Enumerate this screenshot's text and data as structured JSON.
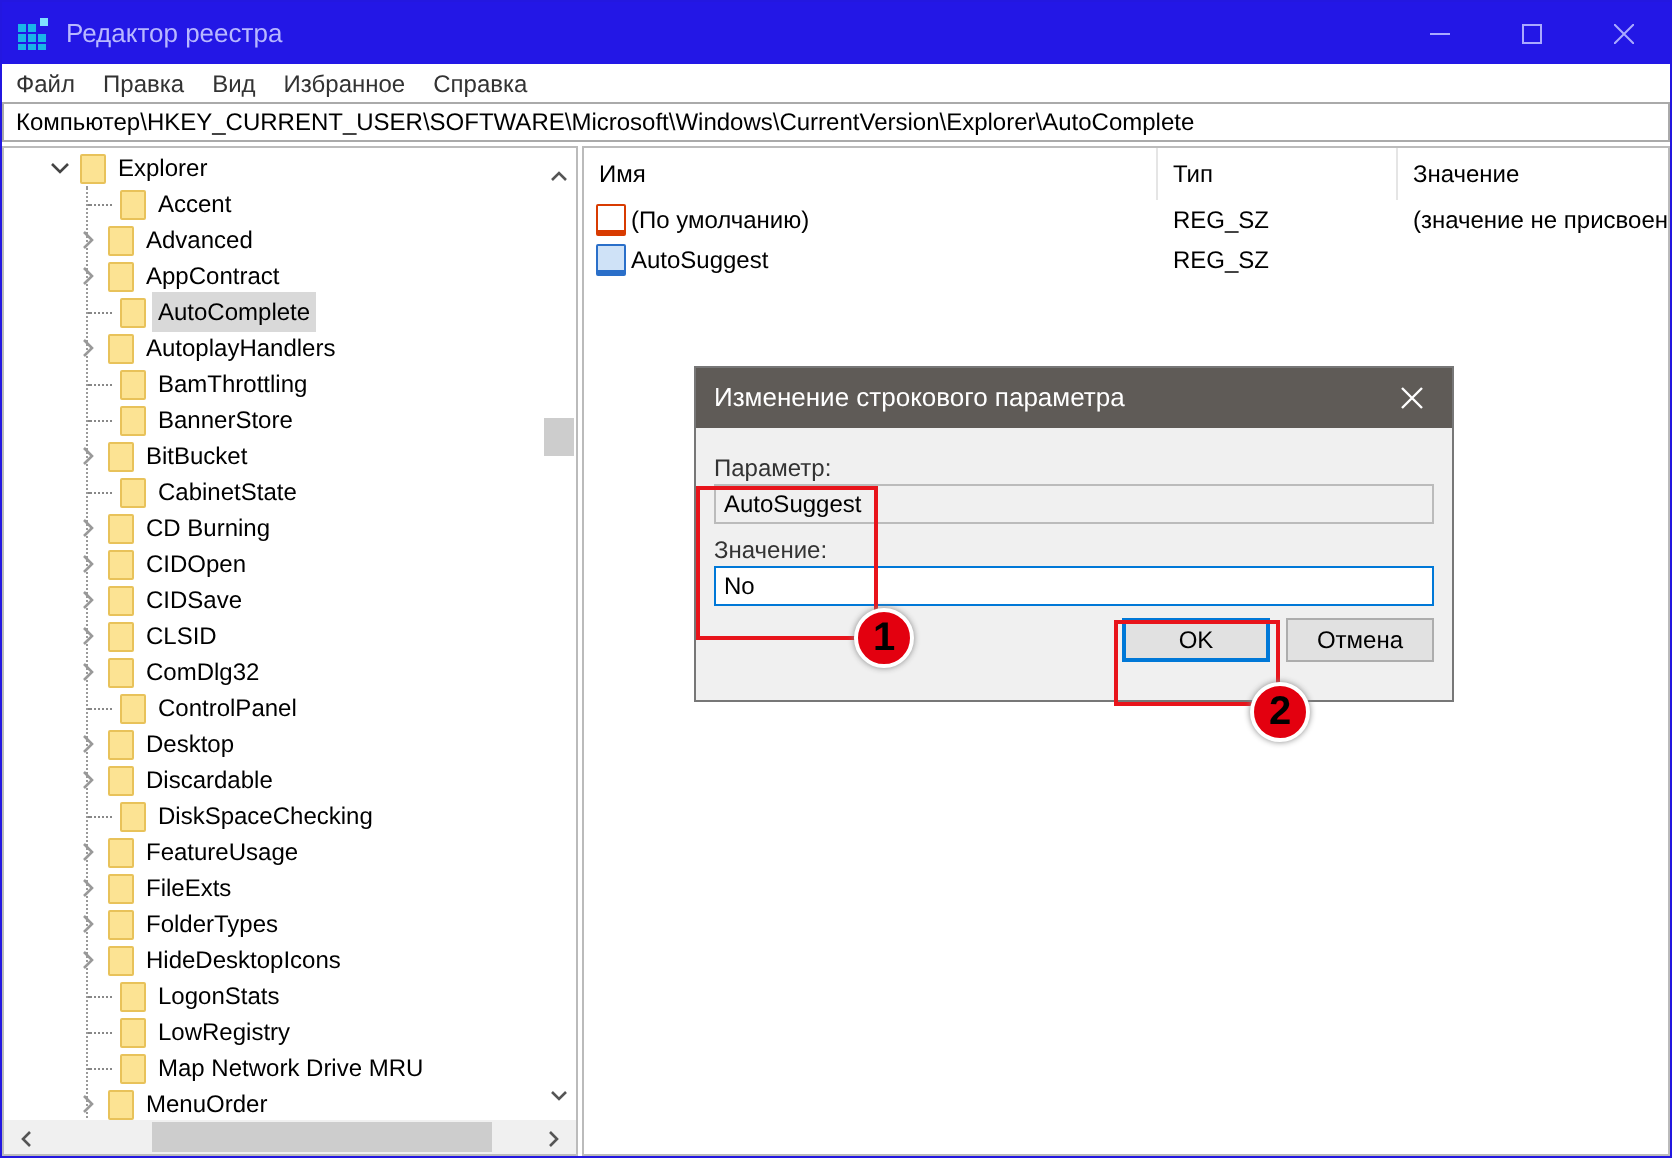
{
  "window": {
    "title": "Редактор реестра"
  },
  "menu": [
    "Файл",
    "Правка",
    "Вид",
    "Избранное",
    "Справка"
  ],
  "address": "Компьютер\\HKEY_CURRENT_USER\\SOFTWARE\\Microsoft\\Windows\\CurrentVersion\\Explorer\\AutoComplete",
  "tree": [
    {
      "label": "Explorer",
      "expanded": true,
      "selected": false,
      "children": [
        {
          "label": "Accent",
          "has_children": false,
          "selected": false
        },
        {
          "label": "Advanced",
          "has_children": true,
          "selected": false
        },
        {
          "label": "AppContract",
          "has_children": true,
          "selected": false
        },
        {
          "label": "AutoComplete",
          "has_children": false,
          "selected": true
        },
        {
          "label": "AutoplayHandlers",
          "has_children": true,
          "selected": false
        },
        {
          "label": "BamThrottling",
          "has_children": false,
          "selected": false
        },
        {
          "label": "BannerStore",
          "has_children": false,
          "selected": false
        },
        {
          "label": "BitBucket",
          "has_children": true,
          "selected": false
        },
        {
          "label": "CabinetState",
          "has_children": false,
          "selected": false
        },
        {
          "label": "CD Burning",
          "has_children": true,
          "selected": false
        },
        {
          "label": "CIDOpen",
          "has_children": true,
          "selected": false
        },
        {
          "label": "CIDSave",
          "has_children": true,
          "selected": false
        },
        {
          "label": "CLSID",
          "has_children": true,
          "selected": false
        },
        {
          "label": "ComDlg32",
          "has_children": true,
          "selected": false
        },
        {
          "label": "ControlPanel",
          "has_children": false,
          "selected": false
        },
        {
          "label": "Desktop",
          "has_children": true,
          "selected": false
        },
        {
          "label": "Discardable",
          "has_children": true,
          "selected": false
        },
        {
          "label": "DiskSpaceChecking",
          "has_children": false,
          "selected": false
        },
        {
          "label": "FeatureUsage",
          "has_children": true,
          "selected": false
        },
        {
          "label": "FileExts",
          "has_children": true,
          "selected": false
        },
        {
          "label": "FolderTypes",
          "has_children": true,
          "selected": false
        },
        {
          "label": "HideDesktopIcons",
          "has_children": true,
          "selected": false
        },
        {
          "label": "LogonStats",
          "has_children": false,
          "selected": false
        },
        {
          "label": "LowRegistry",
          "has_children": false,
          "selected": false
        },
        {
          "label": "Map Network Drive MRU",
          "has_children": false,
          "selected": false
        },
        {
          "label": "MenuOrder",
          "has_children": true,
          "selected": false
        }
      ]
    }
  ],
  "list": {
    "columns": [
      "Имя",
      "Тип",
      "Значение"
    ],
    "rows": [
      {
        "name": "(По умолчанию)",
        "type": "REG_SZ",
        "data": "(значение не присвоен",
        "kind": "default"
      },
      {
        "name": "AutoSuggest",
        "type": "REG_SZ",
        "kind": "string"
      }
    ]
  },
  "dialog": {
    "title": "Изменение строкового параметра",
    "fields": [
      {
        "label": "Параметр:",
        "value": "AutoSuggest",
        "readonly": true
      },
      {
        "label": "Значение:",
        "value": "No",
        "readonly": false
      }
    ],
    "buttons": [
      {
        "label": "OK",
        "default": true
      },
      {
        "label": "Отмена",
        "default": false
      }
    ]
  },
  "callouts": [
    {
      "label": "1"
    },
    {
      "label": "2"
    }
  ]
}
